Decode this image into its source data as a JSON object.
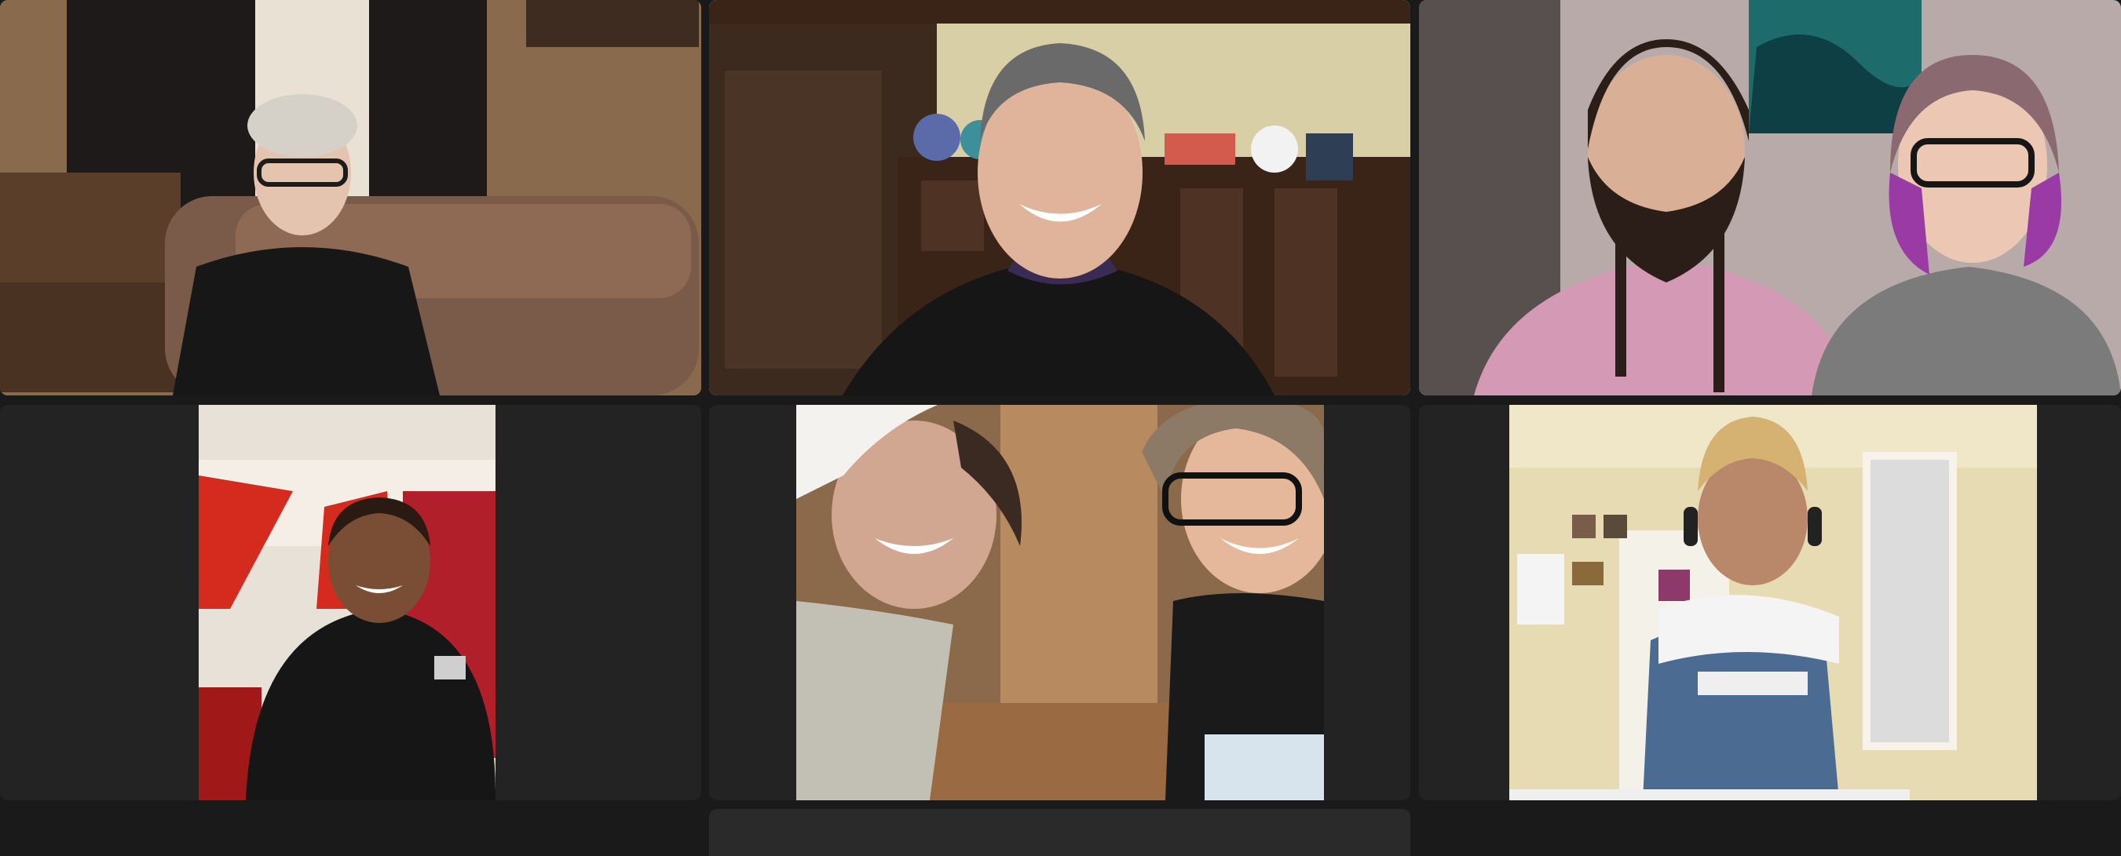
{
  "app": {
    "accent_color": "#29cc52",
    "background_color": "#1a1a1a",
    "tile_background_color": "#232323"
  },
  "gallery": {
    "active_speaker_index": 1,
    "participants": [
      {
        "name": "",
        "scene": "older-woman-glasses-on-floral-couch",
        "active": false
      },
      {
        "name": "",
        "scene": "smiling-man-wood-panel-wall",
        "active": true
      },
      {
        "name": "",
        "scene": "bearded-man-and-woman-purple-hair",
        "active": false
      },
      {
        "name": "",
        "scene": "woman-black-tshirt-red-curtain",
        "active": false
      },
      {
        "name": "",
        "scene": "two-women-close-selfie",
        "active": false
      },
      {
        "name": "",
        "scene": "person-with-beanie-overalls-headphones",
        "active": false
      }
    ]
  }
}
